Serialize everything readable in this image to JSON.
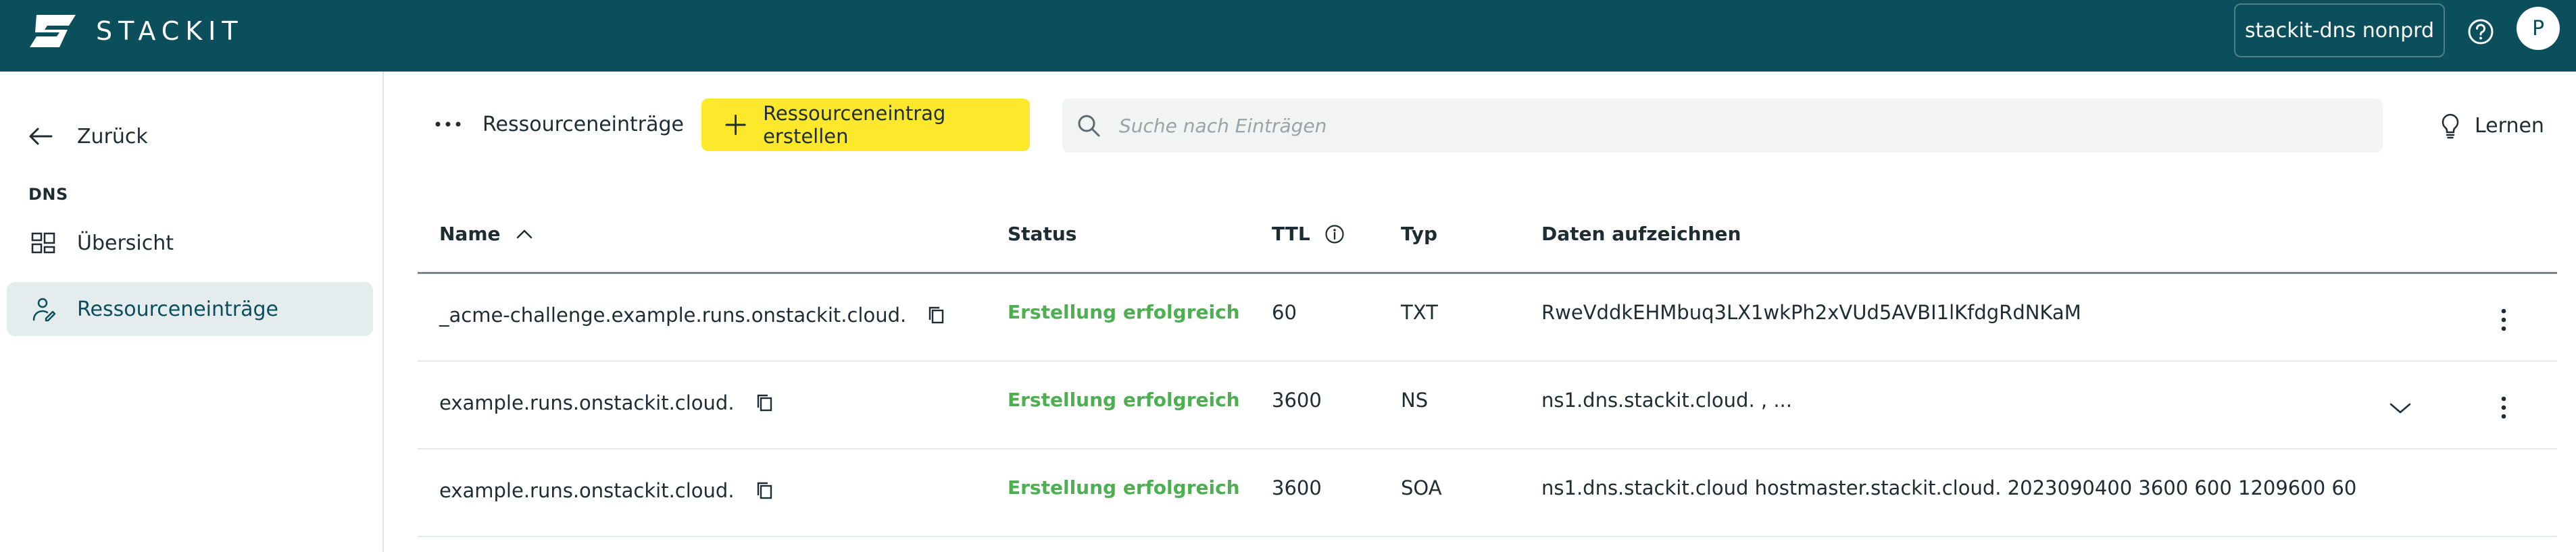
{
  "header": {
    "logo_text": "STACKIT",
    "project": "stackit-dns nonprd",
    "avatar_initial": "P"
  },
  "sidebar": {
    "back_label": "Zurück",
    "section_label": "DNS",
    "items": [
      {
        "label": "Übersicht",
        "icon": "dashboard-icon",
        "active": false
      },
      {
        "label": "Ressourceneinträge",
        "icon": "records-icon",
        "active": true
      }
    ]
  },
  "toolbar": {
    "menu_label": "Ressourceneinträge",
    "create_label": "Ressourceneintrag erstellen",
    "search_placeholder": "Suche nach Einträgen",
    "learn_label": "Lernen"
  },
  "table": {
    "columns": [
      "Name",
      "Status",
      "TTL",
      "Typ",
      "Daten aufzeichnen"
    ],
    "rows": [
      {
        "name": "_acme-challenge.example.runs.onstackit.cloud.",
        "status": "Erstellung erfolgreich",
        "ttl": "60",
        "type": "TXT",
        "data": "RweVddkEHMbuq3LX1wkPh2xVUd5AVBI1lKfdgRdNKaM",
        "expandable": false
      },
      {
        "name": "example.runs.onstackit.cloud.",
        "status": "Erstellung erfolgreich",
        "ttl": "3600",
        "type": "NS",
        "data": "ns1.dns.stackit.cloud. , ...",
        "expandable": true
      },
      {
        "name": "example.runs.onstackit.cloud.",
        "status": "Erstellung erfolgreich",
        "ttl": "3600",
        "type": "SOA",
        "data": "ns1.dns.stackit.cloud hostmaster.stackit.cloud. 2023090400 3600 600 1209600 60",
        "expandable": false
      }
    ]
  },
  "colors": {
    "header_bg": "#0b4f5c",
    "accent_yellow": "#fde82b",
    "status_success": "#4caf50",
    "active_nav_bg": "#e4ecee"
  }
}
